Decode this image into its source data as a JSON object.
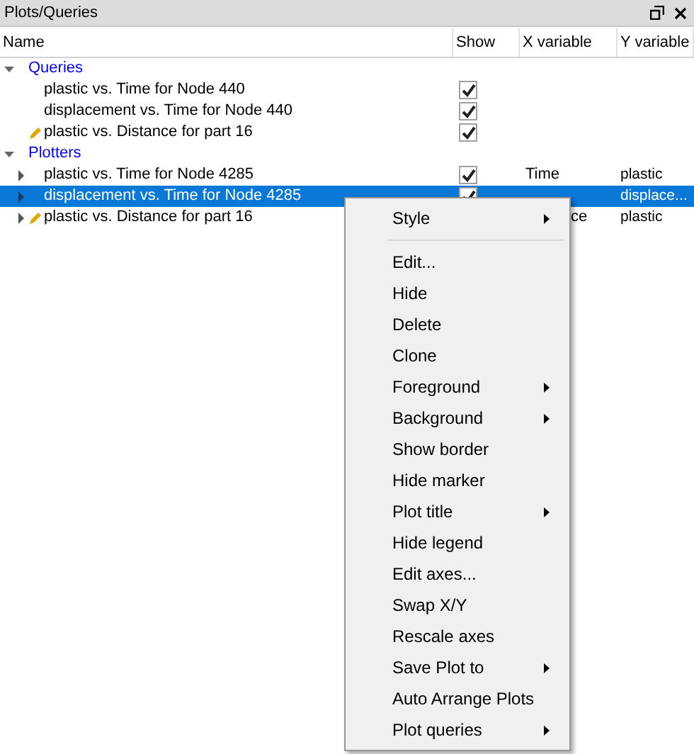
{
  "panel": {
    "title": "Plots/Queries"
  },
  "columns": [
    "Name",
    "Show",
    "X variable",
    "Y variable"
  ],
  "groups": [
    {
      "label": "Queries",
      "expanded": true,
      "rows": [
        {
          "name": "plastic vs. Time for Node 440",
          "show": true,
          "pencil": false,
          "expandable": false,
          "selected": false
        },
        {
          "name": "displacement vs. Time for Node 440",
          "show": true,
          "pencil": false,
          "expandable": false,
          "selected": false
        },
        {
          "name": "plastic vs. Distance for part 16",
          "show": true,
          "pencil": true,
          "expandable": false,
          "selected": false
        }
      ]
    },
    {
      "label": "Plotters",
      "expanded": true,
      "rows": [
        {
          "name": "plastic vs. Time for Node 4285",
          "show": true,
          "pencil": false,
          "expandable": true,
          "selected": false,
          "x": "Time",
          "y": "plastic"
        },
        {
          "name": "displacement vs. Time for Node 4285",
          "show": true,
          "pencil": false,
          "expandable": true,
          "selected": true,
          "y": "displace..."
        },
        {
          "name": "plastic vs. Distance for part 16",
          "pencil": true,
          "expandable": true,
          "selected": false,
          "x": "ce",
          "x_tail": true,
          "y": "plastic"
        }
      ]
    }
  ],
  "menu": [
    {
      "label": "Style",
      "submenu": true,
      "separator_after": true
    },
    {
      "label": "Edit...",
      "submenu": false
    },
    {
      "label": "Hide",
      "submenu": false
    },
    {
      "label": "Delete",
      "submenu": false
    },
    {
      "label": "Clone",
      "submenu": false
    },
    {
      "label": "Foreground",
      "submenu": true
    },
    {
      "label": "Background",
      "submenu": true
    },
    {
      "label": "Show border",
      "submenu": false
    },
    {
      "label": "Hide marker",
      "submenu": false
    },
    {
      "label": "Plot title",
      "submenu": true
    },
    {
      "label": "Hide legend",
      "submenu": false
    },
    {
      "label": "Edit axes...",
      "submenu": false
    },
    {
      "label": "Swap X/Y",
      "submenu": false
    },
    {
      "label": "Rescale axes",
      "submenu": false
    },
    {
      "label": "Save Plot to",
      "submenu": true
    },
    {
      "label": "Auto Arrange Plots",
      "submenu": false
    },
    {
      "label": "Plot queries",
      "submenu": true
    }
  ]
}
